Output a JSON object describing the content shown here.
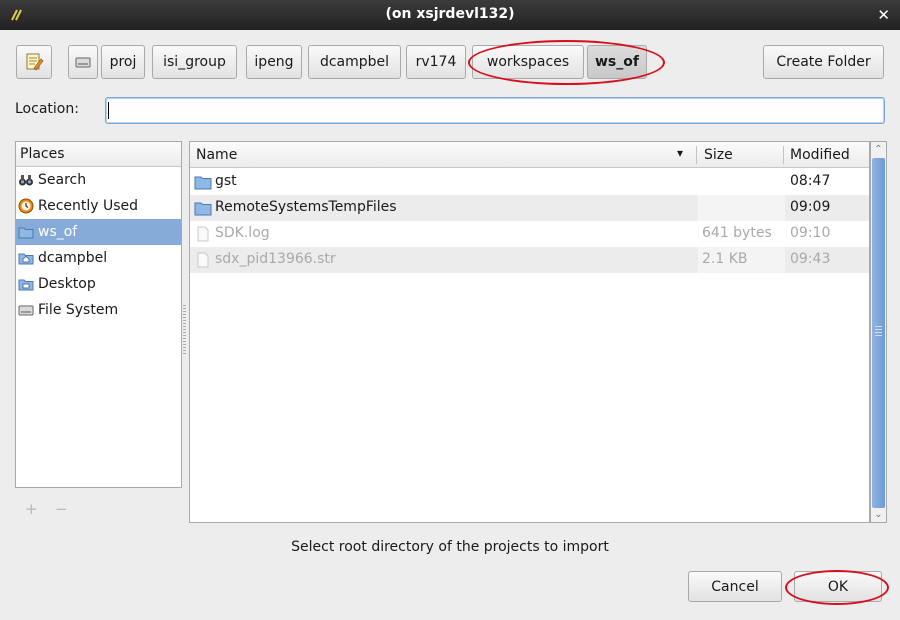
{
  "window": {
    "title": "(on xsjrdevl132)"
  },
  "breadcrumb": {
    "segments": [
      "proj",
      "isi_group",
      "ipeng",
      "dcampbel",
      "rv174",
      "workspaces",
      "ws_of"
    ],
    "active": "ws_of"
  },
  "toolbar": {
    "create_folder": "Create Folder"
  },
  "location": {
    "label": "Location:",
    "value": ""
  },
  "places": {
    "header": "Places",
    "items": [
      {
        "label": "Search",
        "icon": "binoculars-icon"
      },
      {
        "label": "Recently Used",
        "icon": "recent-icon"
      },
      {
        "label": "ws_of",
        "icon": "folder-icon",
        "selected": true
      },
      {
        "label": "dcampbel",
        "icon": "home-folder-icon"
      },
      {
        "label": "Desktop",
        "icon": "desktop-folder-icon"
      },
      {
        "label": "File System",
        "icon": "drive-icon"
      }
    ],
    "add_symbol": "+",
    "remove_symbol": "−"
  },
  "files": {
    "columns": {
      "name": "Name",
      "size": "Size",
      "modified": "Modified"
    },
    "sort_indicator": "▾",
    "rows": [
      {
        "name": "gst",
        "type": "folder",
        "size": "",
        "modified": "08:47",
        "dim": false
      },
      {
        "name": "RemoteSystemsTempFiles",
        "type": "folder",
        "size": "",
        "modified": "09:09",
        "dim": false
      },
      {
        "name": "SDK.log",
        "type": "file",
        "size": "641 bytes",
        "modified": "09:10",
        "dim": true
      },
      {
        "name": "sdx_pid13966.str",
        "type": "file",
        "size": "2.1 KB",
        "modified": "09:43",
        "dim": true
      }
    ]
  },
  "hint": "Select root directory of the projects to import",
  "buttons": {
    "cancel": "Cancel",
    "ok": "OK"
  },
  "colors": {
    "annotation": "#d6101a",
    "selection": "#86abd9",
    "titlebar": "#2b2b2b"
  }
}
